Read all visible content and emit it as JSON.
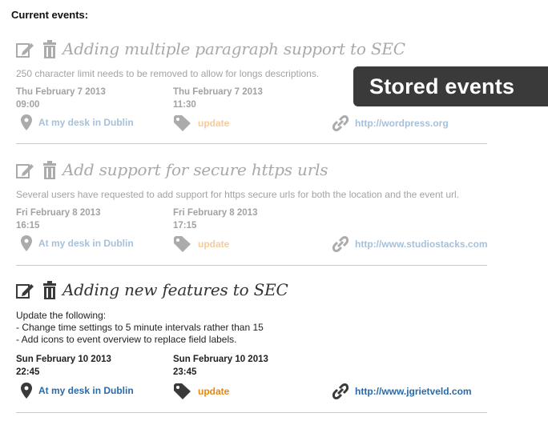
{
  "heading": "Current events:",
  "overlay_label": "Stored events",
  "colors": {
    "location": "#2a6aa8",
    "category": "#e8860c",
    "url": "#2a6aa8",
    "icon": "#3a3a3a"
  },
  "icons": {
    "edit": "edit-icon",
    "delete": "trash-icon",
    "location": "map-pin-icon",
    "category": "tag-icon",
    "url": "link-icon"
  },
  "events": [
    {
      "title": "Adding multiple paragraph support to SEC",
      "description": "250 character limit needs to be removed to allow for longs descriptions.",
      "start_date": "Thu February 7 2013",
      "start_time": "09:00",
      "end_date": "Thu February 7 2013",
      "end_time": "11:30",
      "location": "At my desk in Dublin",
      "category": "update",
      "url": "http://wordpress.org"
    },
    {
      "title": "Add support for secure https urls",
      "description": "Several users have requested to add support for https secure urls for both the location and the event url.",
      "start_date": "Fri February 8 2013",
      "start_time": "16:15",
      "end_date": "Fri February 8 2013",
      "end_time": "17:15",
      "location": "At my desk in Dublin",
      "category": "update",
      "url": "http://www.studiostacks.com"
    },
    {
      "title": "Adding new features to SEC",
      "description": "Update the following:\n- Change time settings to 5 minute intervals rather than 15\n- Add icons to event overview to replace field labels.",
      "start_date": "Sun February 10 2013",
      "start_time": "22:45",
      "end_date": "Sun February 10 2013",
      "end_time": "23:45",
      "location": "At my desk in Dublin",
      "category": "update",
      "url": "http://www.jgrietveld.com"
    }
  ]
}
